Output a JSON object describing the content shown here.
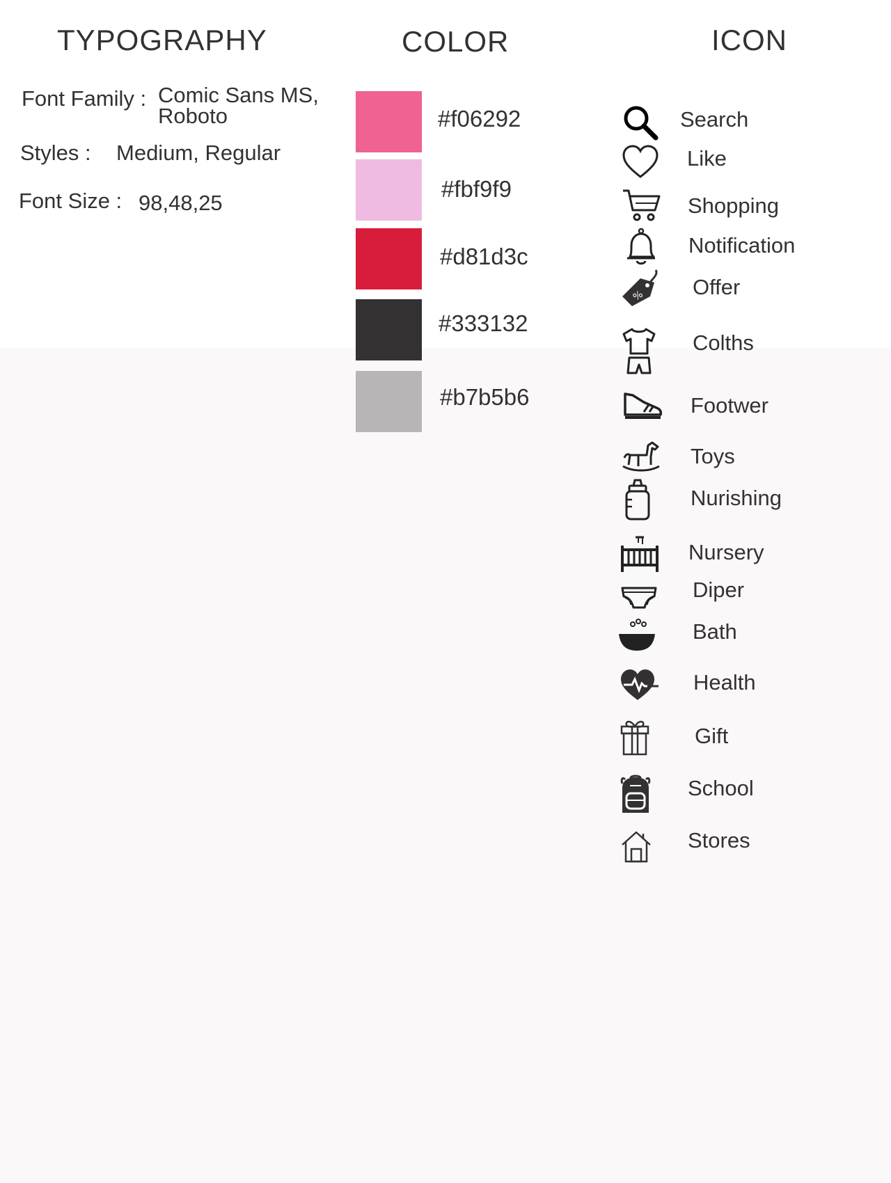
{
  "typography": {
    "title": "TYPOGRAPHY",
    "family_label": "Font Family :",
    "family_value_line1": "Comic Sans MS,",
    "family_value_line2": "Roboto",
    "styles_label": "Styles :",
    "styles_value": "Medium, Regular",
    "size_label": "Font Size :",
    "size_value": "98,48,25"
  },
  "color": {
    "title": "COLOR",
    "swatches": [
      {
        "hex": "#f06292",
        "label": "#f06292"
      },
      {
        "hex": "#f0bbe3",
        "label": "#fbf9f9"
      },
      {
        "hex": "#d81d3c",
        "label": "#d81d3c"
      },
      {
        "hex": "#333132",
        "label": "#333132"
      },
      {
        "hex": "#b7b5b6",
        "label": "#b7b5b6"
      }
    ]
  },
  "icon": {
    "title": "ICON",
    "items": [
      {
        "icon": "search-icon",
        "label": "Search"
      },
      {
        "icon": "heart-icon",
        "label": "Like"
      },
      {
        "icon": "cart-icon",
        "label": "Shopping"
      },
      {
        "icon": "bell-icon",
        "label": "Notification"
      },
      {
        "icon": "tag-icon",
        "label": "Offer"
      },
      {
        "icon": "clothes-icon",
        "label": "Colths"
      },
      {
        "icon": "shoe-icon",
        "label": "Footwer"
      },
      {
        "icon": "rocking-horse-icon",
        "label": "Toys"
      },
      {
        "icon": "baby-bottle-icon",
        "label": "Nurishing"
      },
      {
        "icon": "crib-icon",
        "label": "Nursery"
      },
      {
        "icon": "diaper-icon",
        "label": "Diper"
      },
      {
        "icon": "bathtub-icon",
        "label": "Bath"
      },
      {
        "icon": "heartbeat-icon",
        "label": "Health"
      },
      {
        "icon": "gift-icon",
        "label": "Gift"
      },
      {
        "icon": "backpack-icon",
        "label": "School"
      },
      {
        "icon": "house-icon",
        "label": "Stores"
      }
    ]
  }
}
